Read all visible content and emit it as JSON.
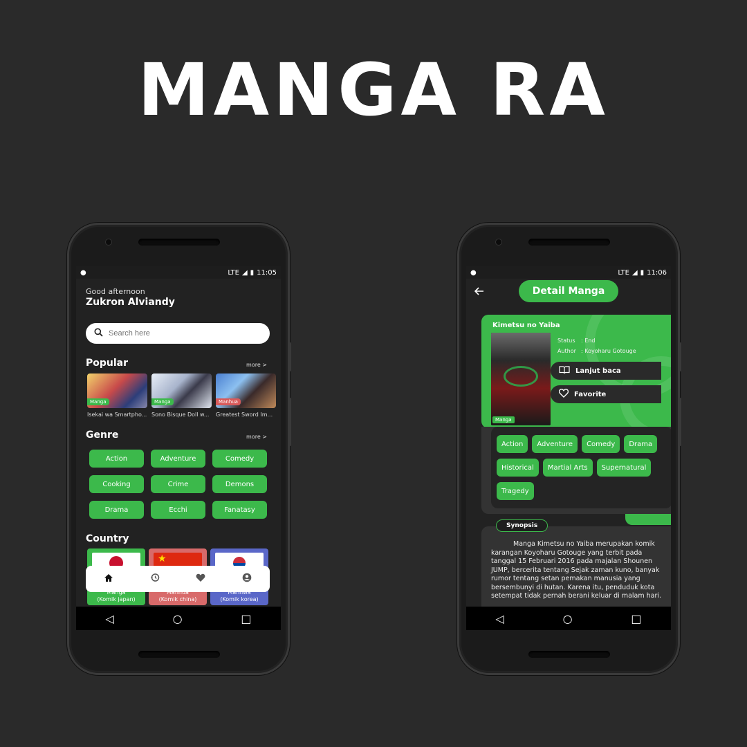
{
  "brand": {
    "title": "MANGA RA"
  },
  "phone1": {
    "status": {
      "time": "11:05",
      "network": "LTE"
    },
    "greeting": "Good afternoon",
    "user_name": "Zukron Alviandy",
    "search": {
      "placeholder": "Search here"
    },
    "popular": {
      "title": "Popular",
      "more": "more >",
      "items": [
        {
          "tag": "Manga",
          "name": "Isekai wa Smartpho...",
          "tag_color": "#3cb94b"
        },
        {
          "tag": "Manga",
          "name": "Sono Bisque Doll w...",
          "tag_color": "#3cb94b"
        },
        {
          "tag": "Manhua",
          "name": "Greatest Sword Im...",
          "tag_color": "#d85a5a"
        }
      ]
    },
    "genre": {
      "title": "Genre",
      "more": "more >",
      "items": [
        "Action",
        "Adventure",
        "Comedy",
        "Cooking",
        "Crime",
        "Demons",
        "Drama",
        "Ecchi",
        "Fanatasy"
      ]
    },
    "country": {
      "title": "Country",
      "items": [
        {
          "name": "Manga",
          "sub": "(Komik japan)",
          "color": "#3cb94b"
        },
        {
          "name": "Manhua",
          "sub": "(Komik china)",
          "color": "#d86a6a"
        },
        {
          "name": "Manhwa",
          "sub": "(Komik korea)",
          "color": "#5a67c8"
        }
      ]
    },
    "bottom_nav": [
      "home-icon",
      "history-icon",
      "heart-icon",
      "profile-icon"
    ]
  },
  "phone2": {
    "status": {
      "time": "11:06",
      "network": "LTE"
    },
    "header": {
      "title": "Detail Manga"
    },
    "manga": {
      "title": "Kimetsu no Yaiba",
      "cover_tag": "Manga",
      "status_label": "Status",
      "status_value": ": End",
      "author_label": "Author",
      "author_value": ": Koyoharu Gotouge"
    },
    "actions": {
      "read": "Lanjut baca",
      "favorite": "Favorite"
    },
    "genres": [
      "Action",
      "Adventure",
      "Comedy",
      "Drama",
      "Historical",
      "Martial Arts",
      "Supernatural",
      "Tragedy"
    ],
    "synopsis": {
      "label": "Synopsis",
      "text": "Manga Kimetsu no Yaiba merupakan komik karangan Koyoharu Gotouge yang terbit pada tanggal 15 Februari 2016 pada majalan Shounen JUMP, bercerita tentang Sejak zaman kuno, banyak rumor tentang setan pemakan manusia yang bersembunyi di hutan. Karena itu, penduduk kota setempat tidak pernah berani keluar di malam hari."
    }
  },
  "colors": {
    "accent": "#3cb94b",
    "background": "#2a2a2a",
    "card": "#333333"
  }
}
